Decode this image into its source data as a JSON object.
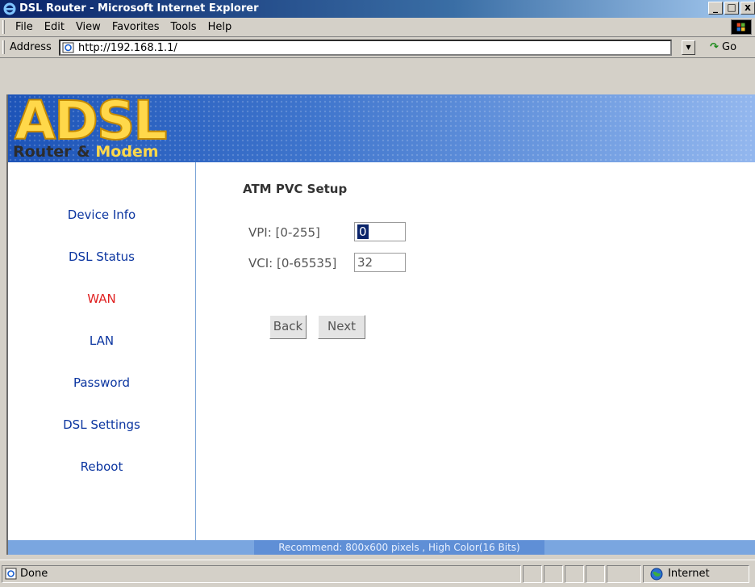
{
  "window": {
    "title": "DSL Router - Microsoft Internet Explorer",
    "buttons": {
      "minimize": "_",
      "maximize": "□",
      "close": "x"
    }
  },
  "menu": {
    "items": [
      {
        "label": "File"
      },
      {
        "label": "Edit"
      },
      {
        "label": "View"
      },
      {
        "label": "Favorites"
      },
      {
        "label": "Tools"
      },
      {
        "label": "Help"
      }
    ]
  },
  "address_bar": {
    "label": "Address",
    "url": "http://192.168.1.1/",
    "go_label": "Go"
  },
  "banner": {
    "logo_text": "ADSL",
    "subtitle_part1": "Router & ",
    "subtitle_part2": "Modem"
  },
  "sidebar": {
    "items": [
      {
        "label": "Device Info",
        "active": false
      },
      {
        "label": "DSL Status",
        "active": false
      },
      {
        "label": "WAN",
        "active": true
      },
      {
        "label": "LAN",
        "active": false
      },
      {
        "label": "Password",
        "active": false
      },
      {
        "label": "DSL Settings",
        "active": false
      },
      {
        "label": "Reboot",
        "active": false
      }
    ]
  },
  "form": {
    "title": "ATM PVC Setup",
    "vpi_label": "VPI: [0-255]",
    "vpi_value": "0",
    "vci_label": "VCI: [0-65535]",
    "vci_value": "32",
    "back_label": "Back",
    "next_label": "Next"
  },
  "footer": {
    "text": "Recommend: 800x600 pixels , High Color(16 Bits)"
  },
  "status_bar": {
    "text": "Done",
    "zone": "Internet"
  },
  "colors": {
    "nav_link": "#0b35a0",
    "nav_active": "#e02020",
    "banner_blue": "#1d54b8",
    "title_bar": "#0a246a"
  }
}
